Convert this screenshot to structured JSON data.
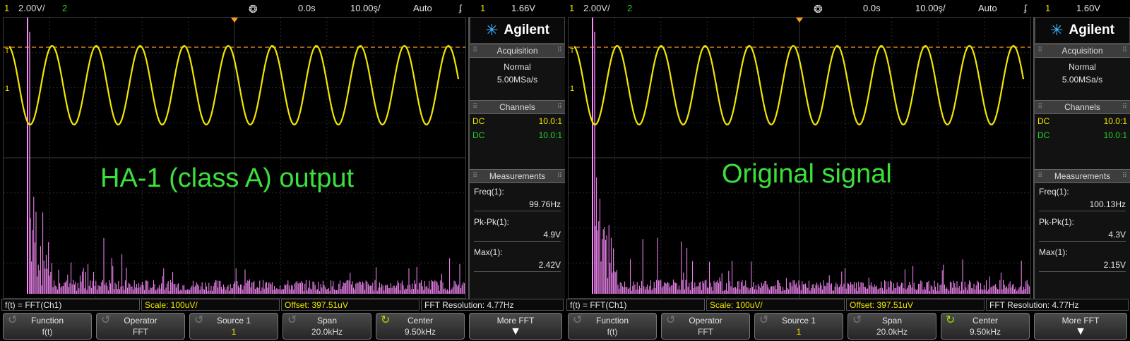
{
  "scopes": [
    {
      "status": {
        "ch1_num": "1",
        "ch1_scale": "2.00V/",
        "ch2_num": "2",
        "trigger_icon": "trigger-position-icon",
        "time_offset": "0.0s",
        "time_scale": "10.00ş/",
        "mode": "Auto",
        "trig_edge": "ʄ",
        "trig_ch": "1",
        "trig_level": "1.66V"
      },
      "overlay_text": "HA-1 (class A) output",
      "brand": "Agilent",
      "acquisition": {
        "header": "Acquisition",
        "mode": "Normal",
        "rate": "5.00MSa/s"
      },
      "channels": {
        "header": "Channels",
        "rows": [
          {
            "coupling": "DC",
            "probe": "10.0:1"
          },
          {
            "coupling": "DC",
            "probe": "10.0:1"
          }
        ]
      },
      "measurements": {
        "header": "Measurements",
        "items": [
          {
            "label": "Freq(1):",
            "value": "99.76Hz"
          },
          {
            "label": "Pk-Pk(1):",
            "value": "4.9V"
          },
          {
            "label": "Max(1):",
            "value": "2.42V"
          }
        ]
      },
      "function_bar": {
        "expr": "f(t) = FFT(Ch1)",
        "scale": "Scale: 100uV/",
        "offset": "Offset: 397.51uV",
        "resolution": "FFT Resolution: 4.77Hz"
      },
      "softkeys": [
        {
          "label": "Function",
          "value": "f(t)"
        },
        {
          "label": "Operator",
          "value": "FFT"
        },
        {
          "label": "Source 1",
          "value": "1"
        },
        {
          "label": "Span",
          "value": "20.0kHz"
        },
        {
          "label": "Center",
          "value": "9.50kHz"
        },
        {
          "label": "More FFT",
          "value": ""
        }
      ],
      "markers": {
        "trigger_level": "T",
        "ch1_ground": "1"
      },
      "waveform": {
        "cycles": 10.2,
        "colors": {
          "ch1": "#f2e600",
          "fft": "#ff8cff"
        }
      }
    },
    {
      "status": {
        "ch1_num": "1",
        "ch1_scale": "2.00V/",
        "ch2_num": "2",
        "trigger_icon": "trigger-position-icon",
        "time_offset": "0.0s",
        "time_scale": "10.00ş/",
        "mode": "Auto",
        "trig_edge": "ʄ",
        "trig_ch": "1",
        "trig_level": "1.60V"
      },
      "overlay_text": "Original signal",
      "brand": "Agilent",
      "acquisition": {
        "header": "Acquisition",
        "mode": "Normal",
        "rate": "5.00MSa/s"
      },
      "channels": {
        "header": "Channels",
        "rows": [
          {
            "coupling": "DC",
            "probe": "10.0:1"
          },
          {
            "coupling": "DC",
            "probe": "10.0:1"
          }
        ]
      },
      "measurements": {
        "header": "Measurements",
        "items": [
          {
            "label": "Freq(1):",
            "value": "100.13Hz"
          },
          {
            "label": "Pk-Pk(1):",
            "value": "4.3V"
          },
          {
            "label": "Max(1):",
            "value": "2.15V"
          }
        ]
      },
      "function_bar": {
        "expr": "f(t) = FFT(Ch1)",
        "scale": "Scale: 100uV/",
        "offset": "Offset: 397.51uV",
        "resolution": "FFT Resolution: 4.77Hz"
      },
      "softkeys": [
        {
          "label": "Function",
          "value": "f(t)"
        },
        {
          "label": "Operator",
          "value": "FFT"
        },
        {
          "label": "Source 1",
          "value": "1"
        },
        {
          "label": "Span",
          "value": "20.0kHz"
        },
        {
          "label": "Center",
          "value": "9.50kHz"
        },
        {
          "label": "More FFT",
          "value": ""
        }
      ],
      "markers": {
        "trigger_level": "T",
        "ch1_ground": "1"
      },
      "waveform": {
        "cycles": 10.2,
        "colors": {
          "ch1": "#f2e600",
          "fft": "#ff8cff"
        }
      }
    }
  ]
}
